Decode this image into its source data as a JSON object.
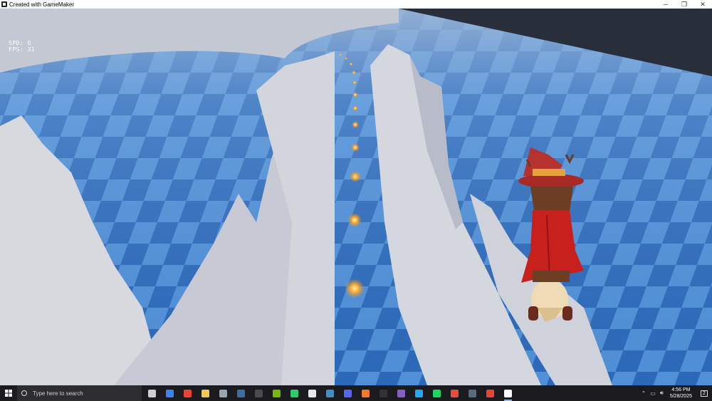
{
  "window": {
    "title": "Created with GameMaker",
    "minimize": "─",
    "maximize": "❐",
    "close": "✕"
  },
  "hud": {
    "speed_label": "SPD: 0",
    "fps_label": "FPS: 31"
  },
  "taskbar": {
    "search_placeholder": "Type here to search",
    "time": "4:56 PM",
    "date": "5/28/2025",
    "apps": [
      {
        "name": "task-view-icon",
        "color": "#cfcfcf"
      },
      {
        "name": "widgets-icon",
        "color": "#3b82f6"
      },
      {
        "name": "chrome-icon",
        "color": "#ea4335"
      },
      {
        "name": "file-explorer-icon",
        "color": "#f2c94c"
      },
      {
        "name": "file-manager-icon",
        "color": "#9aa4b1"
      },
      {
        "name": "steam-icon",
        "color": "#3a6ea5"
      },
      {
        "name": "app-icon",
        "color": "#4b4b4b"
      },
      {
        "name": "nvidia-icon",
        "color": "#76b900"
      },
      {
        "name": "git-icon",
        "color": "#2ecc71"
      },
      {
        "name": "gamemaker-icon",
        "color": "#e8e8e8"
      },
      {
        "name": "godot-icon",
        "color": "#478cbf"
      },
      {
        "name": "discord-icon",
        "color": "#5865f2"
      },
      {
        "name": "blender-icon",
        "color": "#f5792a"
      },
      {
        "name": "epic-games-icon",
        "color": "#333333"
      },
      {
        "name": "visual-studio-icon",
        "color": "#865fc5"
      },
      {
        "name": "vscode-icon",
        "color": "#23a9f2"
      },
      {
        "name": "spotify-icon",
        "color": "#1ed760"
      },
      {
        "name": "browser-icon",
        "color": "#e74c3c"
      },
      {
        "name": "calculator-icon",
        "color": "#5b6b7b"
      },
      {
        "name": "chrome-alt-icon",
        "color": "#ea4335"
      },
      {
        "name": "gamemaker-runner-icon",
        "color": "#ffffff"
      }
    ],
    "notification_count": "2"
  },
  "colors": {
    "accent": "#7ab3ff",
    "floor_light": "#4f8fd6",
    "floor_dark": "#1e5aa8",
    "wall": "#c9ccd6",
    "hat": "#b5322f",
    "coat": "#c8201d",
    "orb": "#ffb43a"
  }
}
